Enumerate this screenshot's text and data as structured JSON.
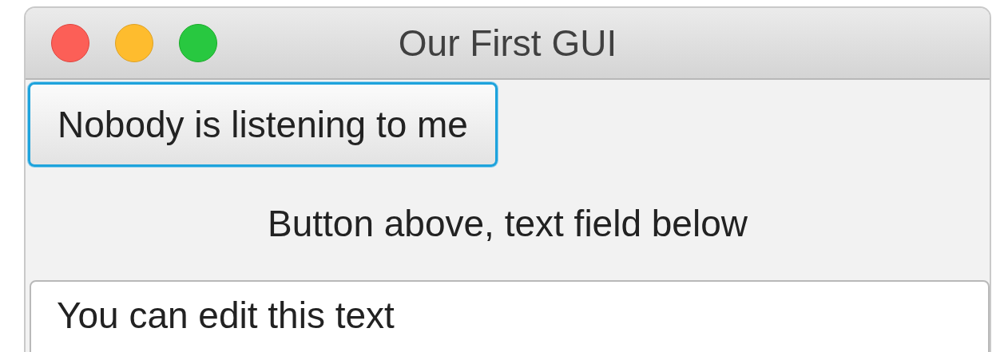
{
  "window": {
    "title": "Our First GUI"
  },
  "button": {
    "label": "Nobody is listening to me",
    "focused": true
  },
  "label": {
    "text": "Button above, text field below"
  },
  "text_field": {
    "value": "You can edit this text"
  }
}
